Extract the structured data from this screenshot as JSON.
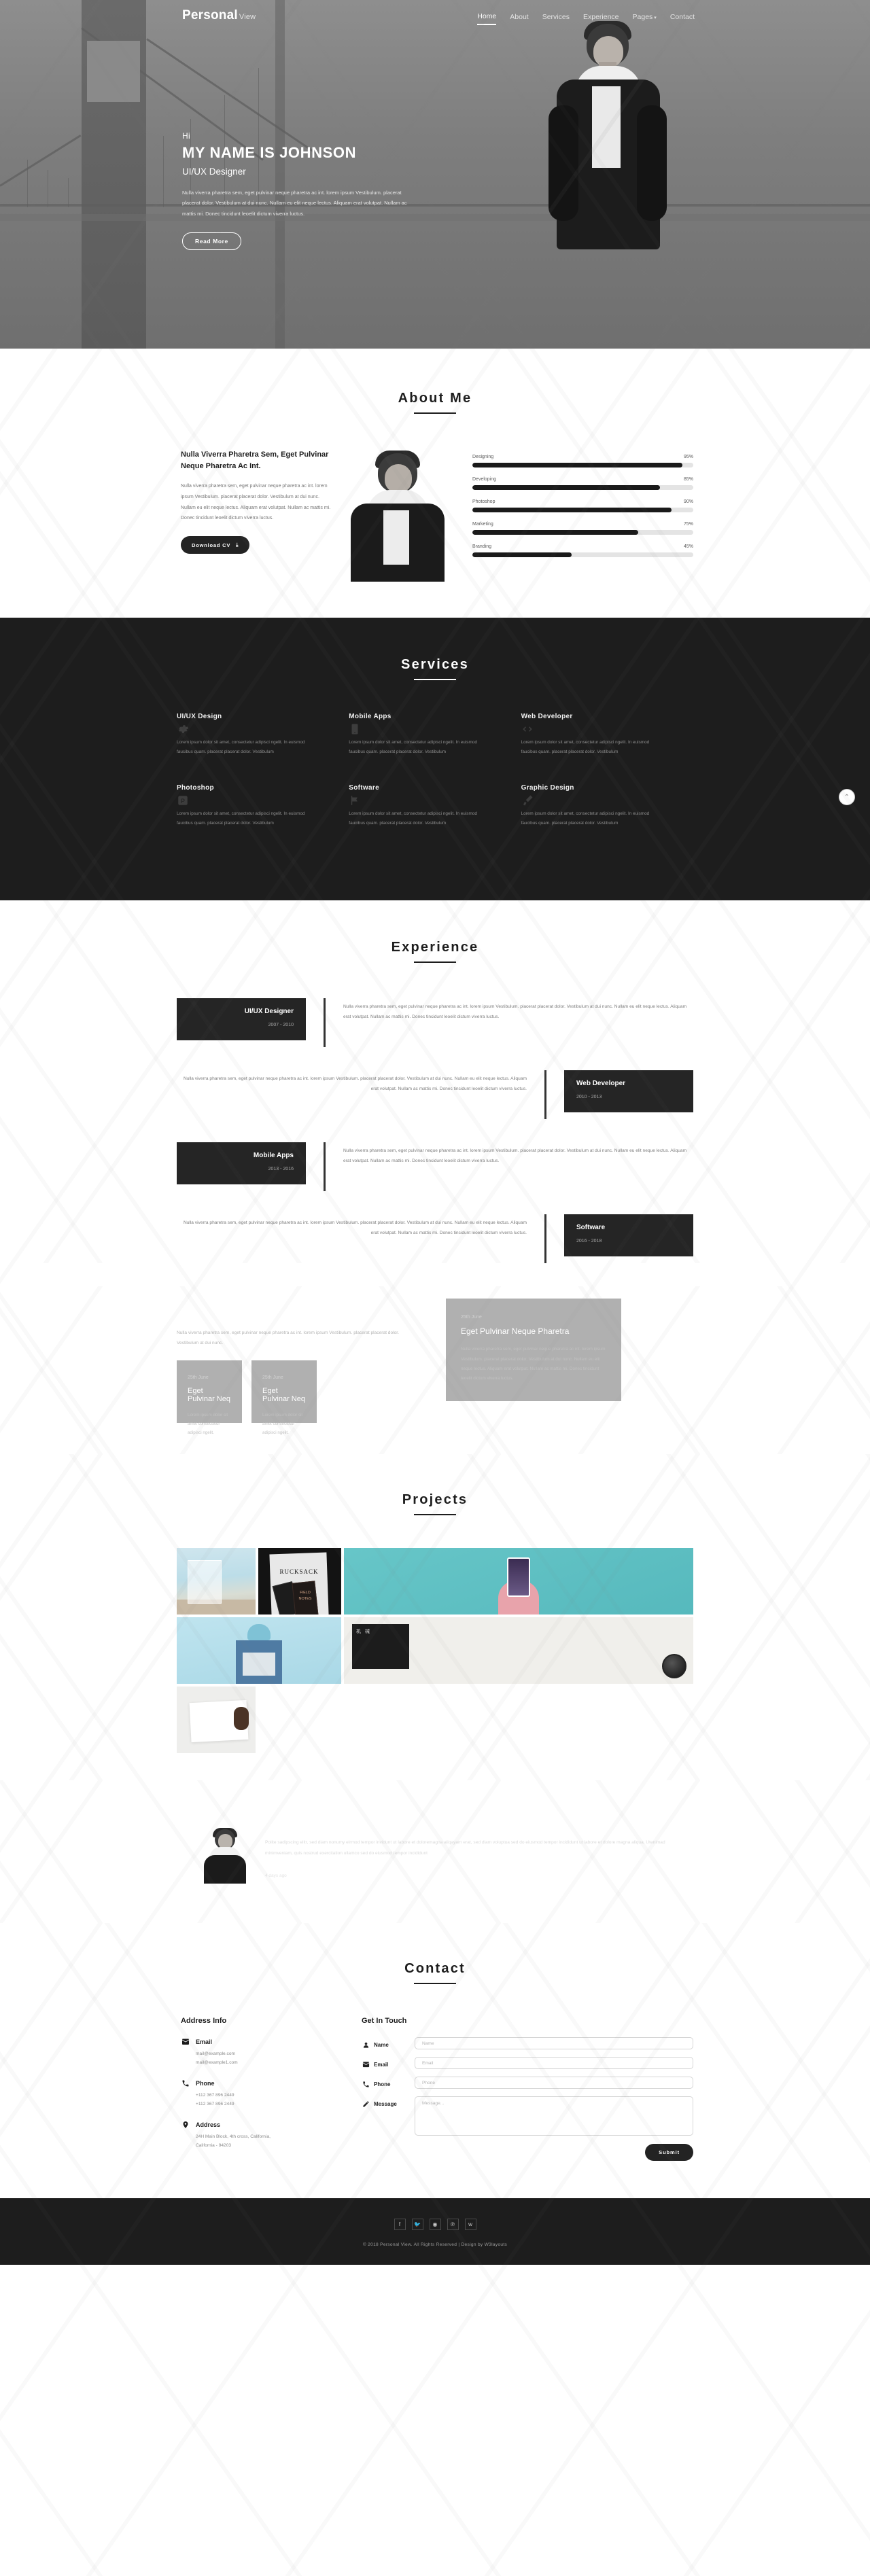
{
  "header": {
    "logo_main": "Personal",
    "logo_sub": "View",
    "nav": [
      {
        "label": "Home",
        "active": true
      },
      {
        "label": "About",
        "active": false
      },
      {
        "label": "Services",
        "active": false
      },
      {
        "label": "Experience",
        "active": false
      },
      {
        "label": "Pages",
        "active": false,
        "caret": "▾"
      },
      {
        "label": "Contact",
        "active": false
      }
    ]
  },
  "hero": {
    "greeting": "Hi",
    "name": "MY NAME IS JOHNSON",
    "role": "UI/UX Designer",
    "description": "Nulla viverra pharetra sem, eget pulvinar neque pharetra ac int. lorem ipsum Vestibulum. placerat placerat dolor. Vestibulum at dui nunc. Nullam eu elit neque lectus. Aliquam erat volutpat. Nullam ac mattis mi. Donec tincidunt leoelit dictum viverra luctus.",
    "cta": "Read More"
  },
  "about": {
    "title": "About Me",
    "heading": "Nulla Viverra Pharetra Sem, Eget Pulvinar Neque Pharetra Ac Int.",
    "paragraph": "Nulla viverra pharetra sem, eget pulvinar neque pharetra ac int. lorem ipsum Vestibulum. placerat placerat dolor. Vestibulum at dui nunc. Nullam eu elit neque lectus. Aliquam erat volutpat. Nullam ac mattis mi. Donec tincidunt leoelit dictum viverra luctus.",
    "download_label": "Download CV",
    "download_icon": "⤓",
    "skills": [
      {
        "name": "Designing",
        "percent": "95%",
        "value": 95
      },
      {
        "name": "Developing",
        "percent": "85%",
        "value": 85
      },
      {
        "name": "Photoshop",
        "percent": "90%",
        "value": 90
      },
      {
        "name": "Marketing",
        "percent": "75%",
        "value": 75
      },
      {
        "name": "Branding",
        "percent": "45%",
        "value": 45
      }
    ]
  },
  "services": {
    "title": "Services",
    "items": [
      {
        "name": "UI/UX Design",
        "text": "Lorem ipsum dolor sit amet, consectetur adipisci ngelit. In euismod faucibus quam. placerat placerat dolor. Vestibulum"
      },
      {
        "name": "Mobile Apps",
        "text": "Lorem ipsum dolor sit amet, consectetur adipisci ngelit. In euismod faucibus quam. placerat placerat dolor. Vestibulum"
      },
      {
        "name": "Web Developer",
        "text": "Lorem ipsum dolor sit amet, consectetur adipisci ngelit. In euismod faucibus quam. placerat placerat dolor. Vestibulum"
      },
      {
        "name": "Photoshop",
        "text": "Lorem ipsum dolor sit amet, consectetur adipisci ngelit. In euismod faucibus quam. placerat placerat dolor. Vestibulum"
      },
      {
        "name": "Software",
        "text": "Lorem ipsum dolor sit amet, consectetur adipisci ngelit. In euismod faucibus quam. placerat placerat dolor. Vestibulum"
      },
      {
        "name": "Graphic Design",
        "text": "Lorem ipsum dolor sit amet, consectetur adipisci ngelit. In euismod faucibus quam. placerat placerat dolor. Vestibulum"
      }
    ]
  },
  "experience": {
    "title": "Experience",
    "body_text": "Nulla viverra pharetra sem, eget pulvinar neque pharetra ac int. lorem ipsum Vestibulum. placerat placerat dolor. Vestibulum at dui nunc. Nullam eu elit neque lectus. Aliquam erat volutpat. Nullam ac mattis mi. Donec tincidunt leoelit dictum viverra luctus.",
    "items": [
      {
        "role": "UI/UX Designer",
        "years": "2007 - 2010",
        "side": "left"
      },
      {
        "role": "Web Developer",
        "years": "2010 - 2013",
        "side": "right"
      },
      {
        "role": "Mobile Apps",
        "years": "2013 - 2016",
        "side": "left"
      },
      {
        "role": "Software",
        "years": "2016 - 2018",
        "side": "right"
      }
    ]
  },
  "blog": {
    "lead": "Nulla viverra pharetra sem, eget pulvinar neque pharetra ac int. lorem ipsum Vestibulum. placerat placerat dolor. Vestibulum at dui nunc.",
    "small_cards": [
      {
        "date": "25th June",
        "title": "Eget Pulvinar Neq",
        "text": "Lorem ipsum dolor sit amet consectetur adipisci ngelit."
      },
      {
        "date": "25th June",
        "title": "Eget Pulvinar Neq",
        "text": "Lorem ipsum dolor sit amet consectetur adipisci ngelit."
      }
    ],
    "feature": {
      "date": "25th June",
      "title": "Eget Pulvinar Neque Pharetra",
      "text": "Nulla viverra pharetra sem, eget pulvinar neque pharetra ac int. lorem ipsum Vestibulum. placerat placerat dolor. Vestibulum at dui nunc. Nullam eu elit neque lectus. Aliquam erat volutpat. Nullam ac mattis mi. Donec tincidunt leoelit dictum viverra luctus."
    }
  },
  "projects": {
    "title": "Projects",
    "items": [
      {
        "label": "beach-frame-mockup"
      },
      {
        "label": "RUCKSACK"
      },
      {
        "label": "phone-poster-woman"
      },
      {
        "label": "denim-jacket-hat"
      },
      {
        "label": "camera-lens-book"
      },
      {
        "label": "open-book-hand"
      }
    ],
    "p2_title": "RUCKSACK",
    "p2_sub": "FIELD NOTES",
    "p5_cjk": "机 械"
  },
  "testimonial": {
    "quote": "Polite sadipscing elitr, sed diam nonumy eirmod tempor invidunt ut labore et doloremagna aliqayam erat, sed diam voluptua sed do eiusmod tempor incididunt ut labore et dolore magna aliqua. Utenimad minimveniam, quis nostrud exercitation ullamco sed do eiusmod tempor incididunt",
    "ago": "4 days ago"
  },
  "contact": {
    "title": "Contact",
    "address_heading": "Address Info",
    "items": [
      {
        "icon": "envelope-icon",
        "glyph": "✉",
        "label": "Email",
        "lines": [
          "mail@example.com",
          "mail@example1.com"
        ]
      },
      {
        "icon": "phone-icon",
        "glyph": "✆",
        "label": "Phone",
        "lines": [
          "+112 367 896 2449",
          "+112 367 896 2449"
        ]
      },
      {
        "icon": "map-pin-icon",
        "glyph": "⚲",
        "label": "Address",
        "lines": [
          "24H Main Block, 4th cross, California,",
          "California - 94203"
        ]
      }
    ],
    "form_heading": "Get In Touch",
    "fields": [
      {
        "icon": "user-icon",
        "glyph": "●",
        "label": "Name",
        "placeholder": "Name",
        "value": "",
        "type": "text"
      },
      {
        "icon": "envelope-icon",
        "glyph": "✉",
        "label": "Email",
        "placeholder": "Email",
        "value": "",
        "type": "text"
      },
      {
        "icon": "phone-icon",
        "glyph": "✆",
        "label": "Phone",
        "placeholder": "Phone",
        "value": "",
        "type": "text"
      },
      {
        "icon": "pencil-icon",
        "glyph": "✎",
        "label": "Message",
        "placeholder": "Message...",
        "value": "",
        "type": "textarea"
      }
    ],
    "submit_label": "Submit"
  },
  "footer": {
    "socials": [
      {
        "name": "facebook-icon",
        "glyph": "f"
      },
      {
        "name": "twitter-icon",
        "glyph": "🐦"
      },
      {
        "name": "dribbble-icon",
        "glyph": "◉"
      },
      {
        "name": "pinterest-icon",
        "glyph": "℗"
      },
      {
        "name": "vk-icon",
        "glyph": "ᴡ"
      }
    ],
    "copyright": "© 2018 Personal View. All Rights Reserved | Design by W3layouts"
  },
  "scroll_top_icon": "⌃",
  "colors": {
    "dark": "#1d1d1d",
    "accent_dark": "#232323",
    "muted": "#8b8b8b"
  }
}
